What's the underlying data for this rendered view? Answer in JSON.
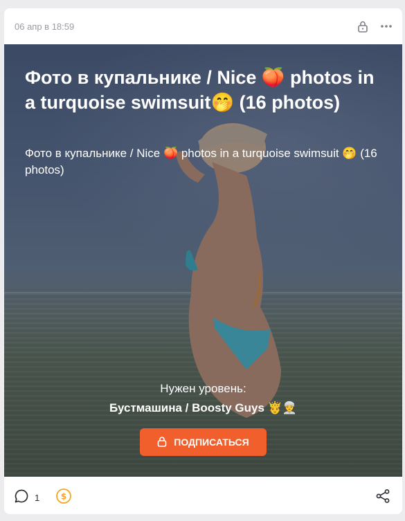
{
  "post": {
    "timestamp": "06 апр в 18:59",
    "title": "Фото в купальнике / Nice 🍑 photos in a turquoise swimsuit🤭 (16 photos)",
    "subtitle": "Фото в купальнике / Nice 🍑 photos in a turquoise swimsuit 🤭 (16 photos)",
    "access": {
      "label": "Нужен уровень:",
      "tier": "Бустмашина / Boosty Guys 🤴👳"
    },
    "subscribe_label": "ПОДПИСАТЬСЯ",
    "comment_count": "1"
  },
  "icons": {
    "header_lock": "lock-icon",
    "header_more": "more-icon",
    "button_lock": "lock-icon",
    "comment": "comment-icon",
    "donate": "coin-icon",
    "share": "share-icon"
  },
  "colors": {
    "accent": "#f15f2c",
    "donate": "#f5a623",
    "muted_text": "#9a9aa2",
    "icon": "#2b2b33"
  }
}
